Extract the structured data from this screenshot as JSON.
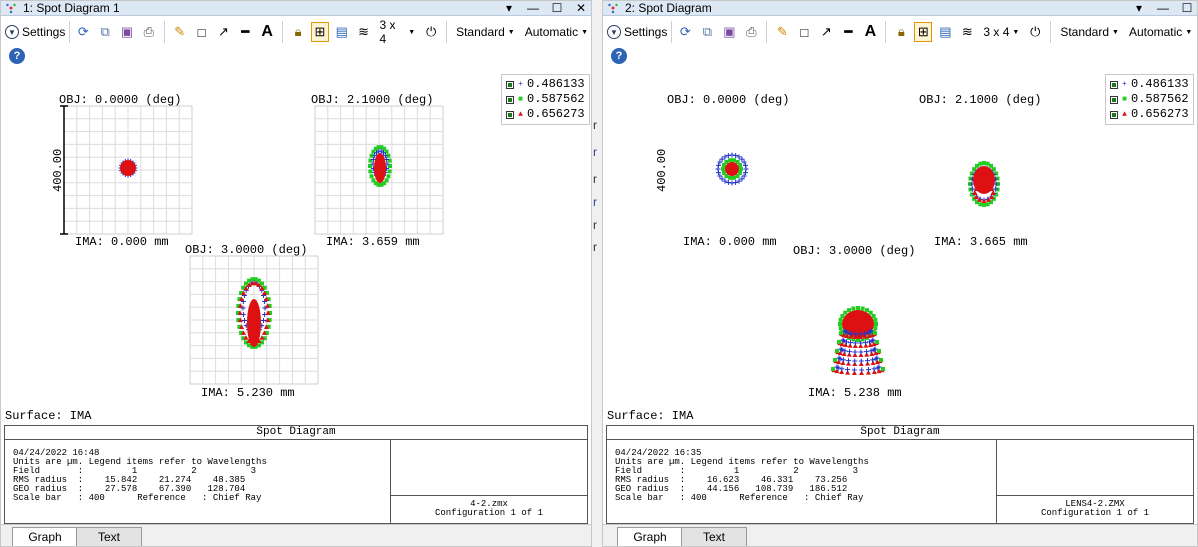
{
  "panels": [
    {
      "title": "1: Spot Diagram 1",
      "toolbar": {
        "settings_label": "Settings",
        "grid_label": "3 x 4",
        "standard_label": "Standard",
        "automatic_label": "Automatic"
      },
      "scale_label": "400.00",
      "legend": [
        "0.486133",
        "0.587562",
        "0.656273"
      ],
      "fields": [
        {
          "obj": "OBJ: 0.0000 (deg)",
          "ima": "IMA: 0.000 mm"
        },
        {
          "obj": "OBJ: 2.1000 (deg)",
          "ima": "IMA: 3.659 mm"
        },
        {
          "obj": "OBJ: 3.0000 (deg)",
          "ima": "IMA: 5.230 mm"
        }
      ],
      "surface": "Surface: IMA",
      "info_title": "Spot Diagram",
      "info_lines": [
        "04/24/2022 16:48",
        "Units are µm. Legend items refer to Wavelengths",
        "Field       :         1          2          3",
        "RMS radius  :    15.842    21.274    48.385",
        "GEO radius  :    27.578    67.390   128.704",
        "Scale bar   : 400      Reference   : Chief Ray"
      ],
      "file_name": "4-2.zmx",
      "config": "Configuration 1 of 1",
      "tabs": [
        "Graph",
        "Text"
      ]
    },
    {
      "title": "2: Spot Diagram",
      "toolbar": {
        "settings_label": "Settings",
        "grid_label": "3 x 4",
        "standard_label": "Standard",
        "automatic_label": "Automatic"
      },
      "scale_label": "400.00",
      "legend": [
        "0.486133",
        "0.587562",
        "0.656273"
      ],
      "fields": [
        {
          "obj": "OBJ: 0.0000 (deg)",
          "ima": "IMA: 0.000 mm"
        },
        {
          "obj": "OBJ: 2.1000 (deg)",
          "ima": "IMA: 3.665 mm"
        },
        {
          "obj": "OBJ: 3.0000 (deg)",
          "ima": "IMA: 5.238 mm"
        }
      ],
      "surface": "Surface: IMA",
      "info_title": "Spot Diagram",
      "info_lines": [
        "04/24/2022 16:35",
        "Units are µm. Legend items refer to Wavelengths",
        "Field       :         1          2          3",
        "RMS radius  :    16.623    46.331    73.256",
        "GEO radius  :    44.156   108.739   186.512",
        "Scale bar   : 400      Reference   : Chief Ray"
      ],
      "file_name": "LENS4-2.ZMX",
      "config": "Configuration 1 of 1",
      "tabs": [
        "Graph",
        "Text"
      ]
    }
  ],
  "colors": {
    "wavelength_1": "#2233cc",
    "wavelength_2": "#22cc22",
    "wavelength_3": "#dd1111",
    "title_bar": "#dde8f5"
  }
}
